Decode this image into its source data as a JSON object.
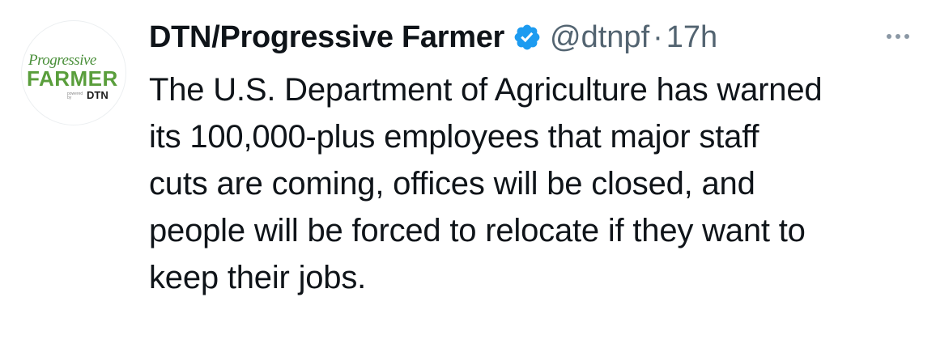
{
  "tweet": {
    "avatar": {
      "logo_line1": "Progressive",
      "logo_line2": "FARMER",
      "logo_powered": "powered by",
      "logo_brand": "DTN"
    },
    "author_name": "DTN/Progressive Farmer",
    "verified_icon": "verified-badge-icon",
    "handle": "@dtnpf",
    "separator": "·",
    "timestamp": "17h",
    "more_icon": "more-horizontal-icon",
    "text": "The U.S. Department of Agriculture has warned\nits 100,000-plus employees that major staff\ncuts are coming, offices will be closed, and\npeople will be forced to relocate if they want to\nkeep their jobs."
  },
  "colors": {
    "verified_blue": "#1d9bf0",
    "text_primary": "#0f1419",
    "text_secondary": "#536471",
    "logo_green": "#5a9e3c"
  }
}
